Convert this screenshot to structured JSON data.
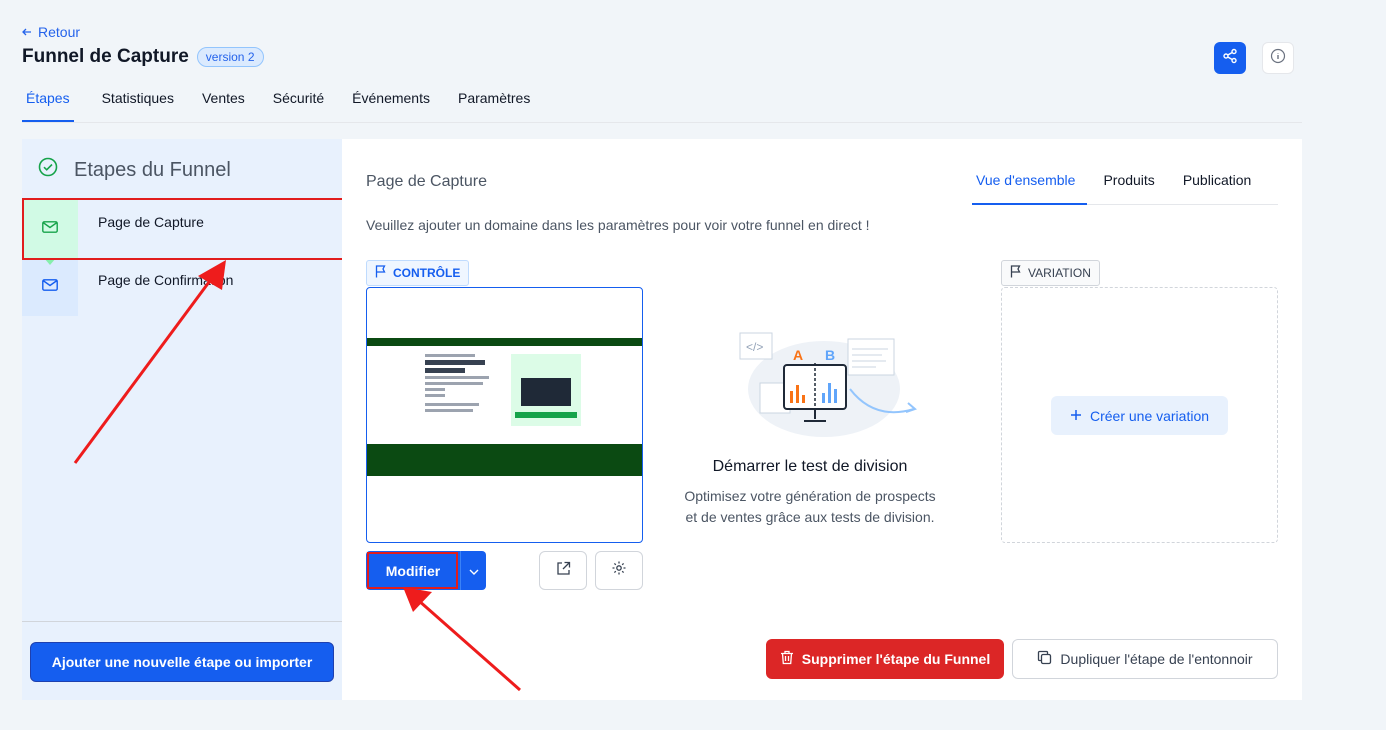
{
  "header": {
    "back_label": "Retour",
    "title": "Funnel de Capture",
    "version": "version 2"
  },
  "nav": {
    "tabs": [
      "Étapes",
      "Statistiques",
      "Ventes",
      "Sécurité",
      "Événements",
      "Paramètres"
    ],
    "active": "Étapes"
  },
  "sidebar": {
    "heading": "Etapes du Funnel",
    "steps": [
      {
        "label": "Page de Capture",
        "icon": "mail-icon",
        "selected": true
      },
      {
        "label": "Page de Confirmation",
        "icon": "mail-icon",
        "selected": false
      }
    ],
    "add_button": "Ajouter une nouvelle étape ou importer"
  },
  "main": {
    "title": "Page de Capture",
    "tabs": [
      "Vue d'ensemble",
      "Produits",
      "Publication"
    ],
    "active_tab": "Vue d'ensemble",
    "notice": "Veuillez ajouter un domaine dans les paramètres pour voir votre funnel en direct !",
    "control_badge": "CONTRÔLE",
    "modify_button": "Modifier",
    "split_test": {
      "ab_a": "A",
      "ab_b": "B",
      "title": "Démarrer le test de division",
      "desc_line1": "Optimisez votre génération de prospects",
      "desc_line2": "et de ventes grâce aux tests de division."
    },
    "variation_badge": "VARIATION",
    "create_variation": "Créer une variation",
    "delete_button": "Supprimer l'étape du Funnel",
    "duplicate_button": "Dupliquer l'étape de l'entonnoir"
  },
  "colors": {
    "primary": "#155eef",
    "danger": "#dc2626",
    "annotation": "#e11d1d",
    "sidebar_bg": "#e8f1fd"
  }
}
